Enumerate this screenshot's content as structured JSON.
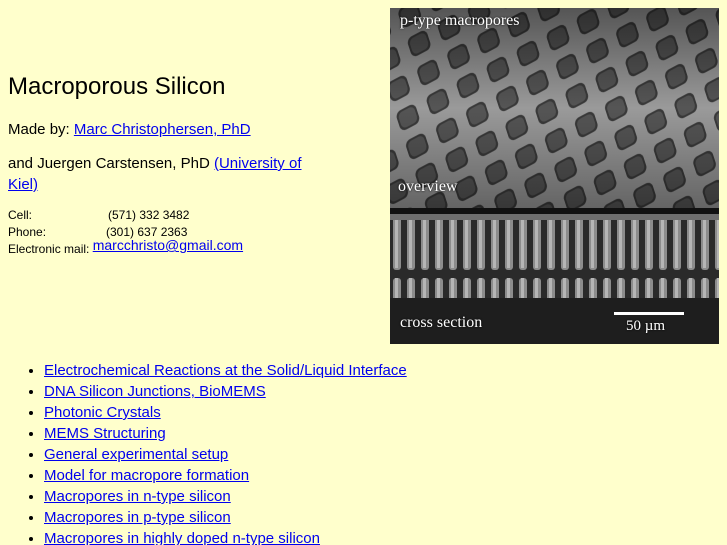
{
  "header": {
    "title": "Macroporous Silicon"
  },
  "authors": {
    "made_by_label": "Made by:",
    "made_by_name": "Marc Christophersen, PhD",
    "coauthor_text": "and Juergen Carstensen, PhD",
    "coauthor_affiliation": "(University of Kiel)"
  },
  "contact": {
    "cell_label": "Cell:",
    "cell_value": "(571) 332 3482",
    "phone_label": "Phone:",
    "phone_value": "(301) 637 2363",
    "email_label": "Electronic mail:",
    "email_value": "marcchristo@gmail.com"
  },
  "photo": {
    "caption_top": "p-type macropores",
    "caption_overview": "overview",
    "caption_cross": "cross section",
    "scale_label": "50 µm"
  },
  "topics": [
    "Electrochemical Reactions at the Solid/Liquid Interface",
    "DNA Silicon Junctions, BioMEMS",
    "Photonic Crystals ",
    "MEMS Structuring",
    "General experimental setup",
    "Model for macropore formation",
    "Macropores in n-type silicon",
    "Macropores in p-type silicon",
    "Macropores in highly doped n-type silicon"
  ],
  "colors": {
    "background": "#ffffcc",
    "link": "#0000ee"
  }
}
